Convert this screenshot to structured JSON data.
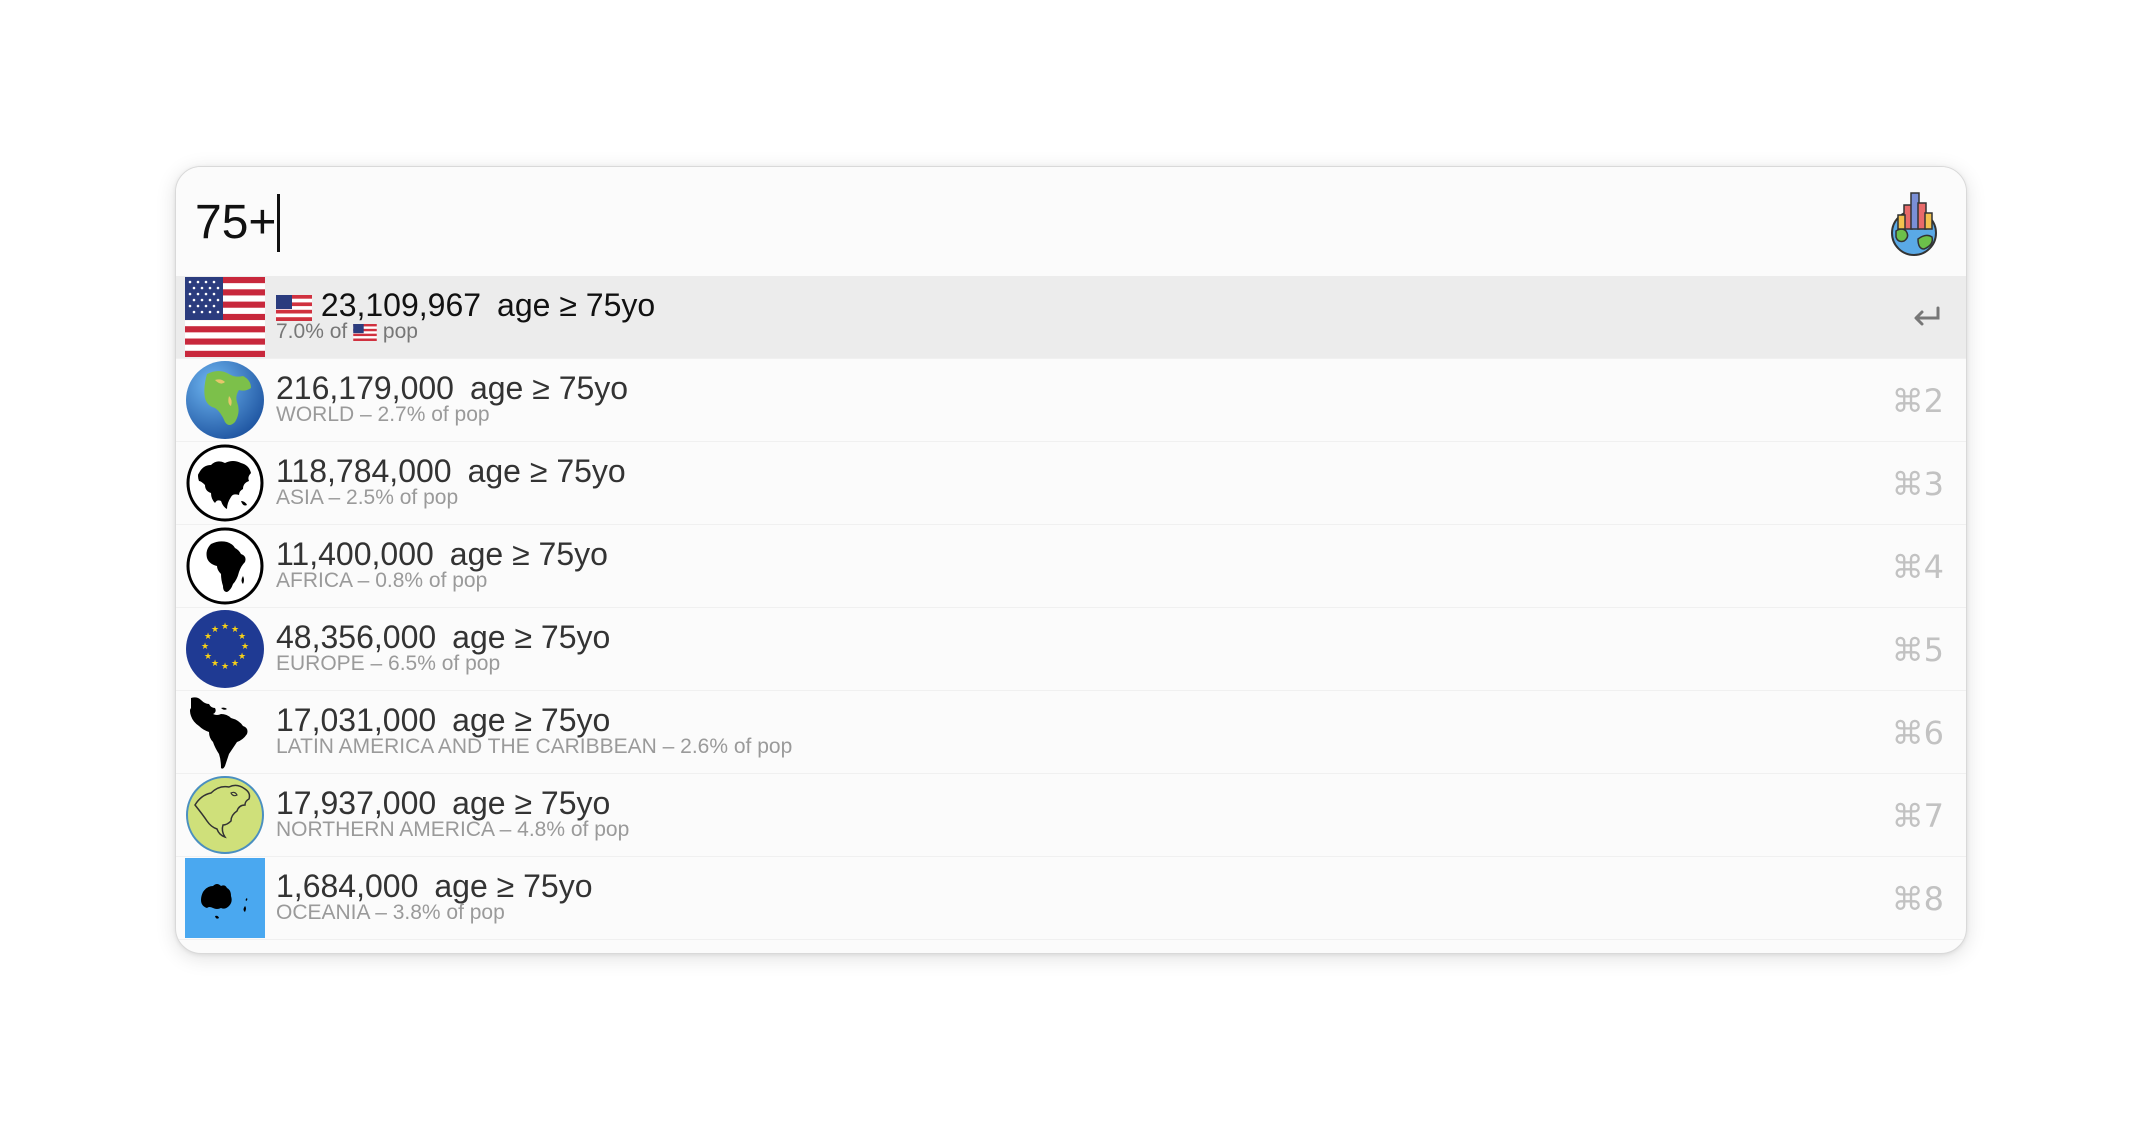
{
  "search": {
    "query": "75+"
  },
  "results": [
    {
      "value": "23,109,967",
      "label": "age ≥ 75yo",
      "sub_prefix": "7.0% of",
      "sub_suffix": "pop",
      "shortcut": "",
      "icon": "us-flag-icon"
    },
    {
      "value": "216,179,000",
      "label": "age ≥ 75yo",
      "sub": "WORLD – 2.7% of pop",
      "shortcut": "⌘2",
      "icon": "globe-icon"
    },
    {
      "value": "118,784,000",
      "label": "age ≥ 75yo",
      "sub": "ASIA – 2.5% of pop",
      "shortcut": "⌘3",
      "icon": "asia-map-icon"
    },
    {
      "value": "11,400,000",
      "label": "age ≥ 75yo",
      "sub": "AFRICA – 0.8% of pop",
      "shortcut": "⌘4",
      "icon": "africa-map-icon"
    },
    {
      "value": "48,356,000",
      "label": "age ≥ 75yo",
      "sub": "EUROPE – 6.5% of pop",
      "shortcut": "⌘5",
      "icon": "eu-flag-icon"
    },
    {
      "value": "17,031,000",
      "label": "age ≥ 75yo",
      "sub": "LATIN AMERICA AND THE CARIBBEAN – 2.6% of pop",
      "shortcut": "⌘6",
      "icon": "latin-america-map-icon"
    },
    {
      "value": "17,937,000",
      "label": "age ≥ 75yo",
      "sub": "NORTHERN AMERICA – 4.8% of pop",
      "shortcut": "⌘7",
      "icon": "north-america-map-icon"
    },
    {
      "value": "1,684,000",
      "label": "age ≥ 75yo",
      "sub": "OCEANIA – 3.8% of pop",
      "shortcut": "⌘8",
      "icon": "oceania-map-icon"
    }
  ],
  "colors": {
    "selected_row": "#ececec",
    "subtext": "#9a9a9a",
    "shortcut": "#c2c2c2",
    "eu_blue": "#1f3a93",
    "oceania_blue": "#4aa8f0"
  }
}
